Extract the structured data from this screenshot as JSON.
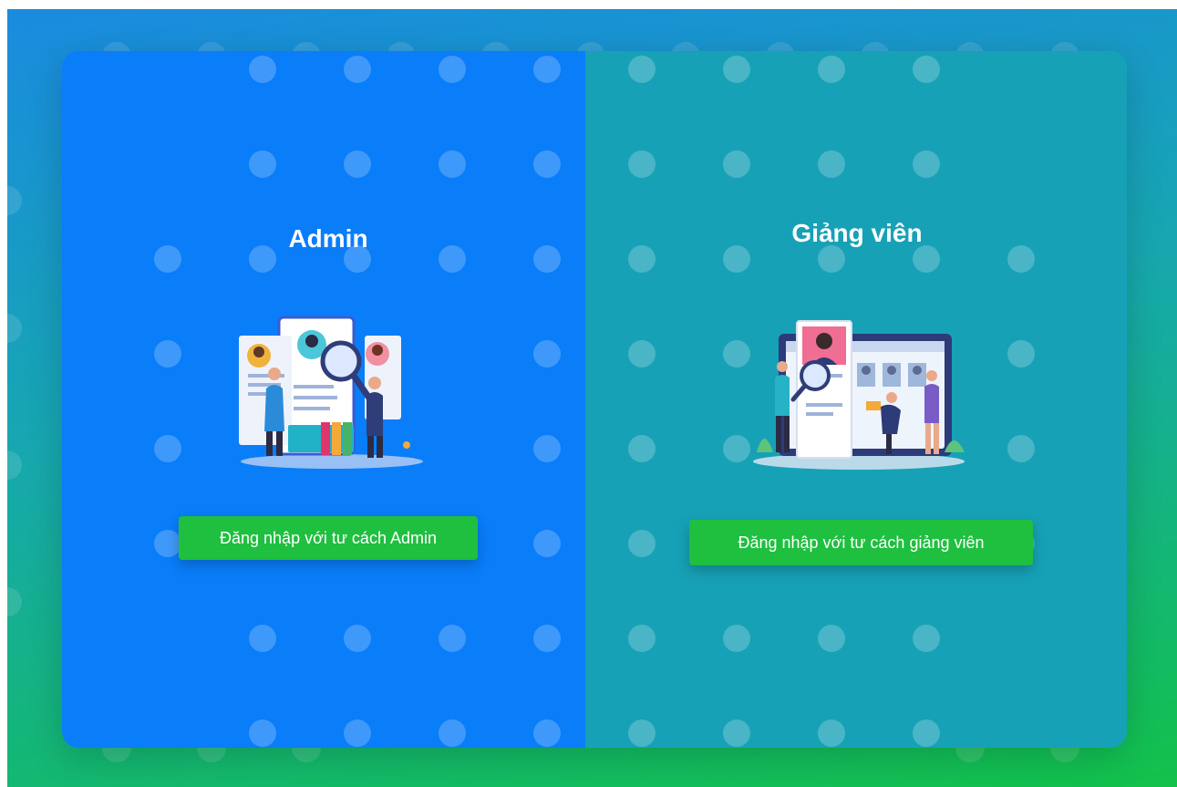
{
  "panels": {
    "admin": {
      "title": "Admin",
      "button_label": "Đăng nhập với tư cách Admin",
      "illustration_icon": "recruitment-search-icon",
      "background": "#0a7df9"
    },
    "teacher": {
      "title": "Giảng viên",
      "button_label": "Đăng nhập với tư cách giảng viên",
      "illustration_icon": "profile-review-icon",
      "background": "#17a1b6"
    }
  },
  "colors": {
    "button": "#1fbf3f",
    "gradient_top": "#1a8be0",
    "gradient_bottom": "#12c24a"
  }
}
